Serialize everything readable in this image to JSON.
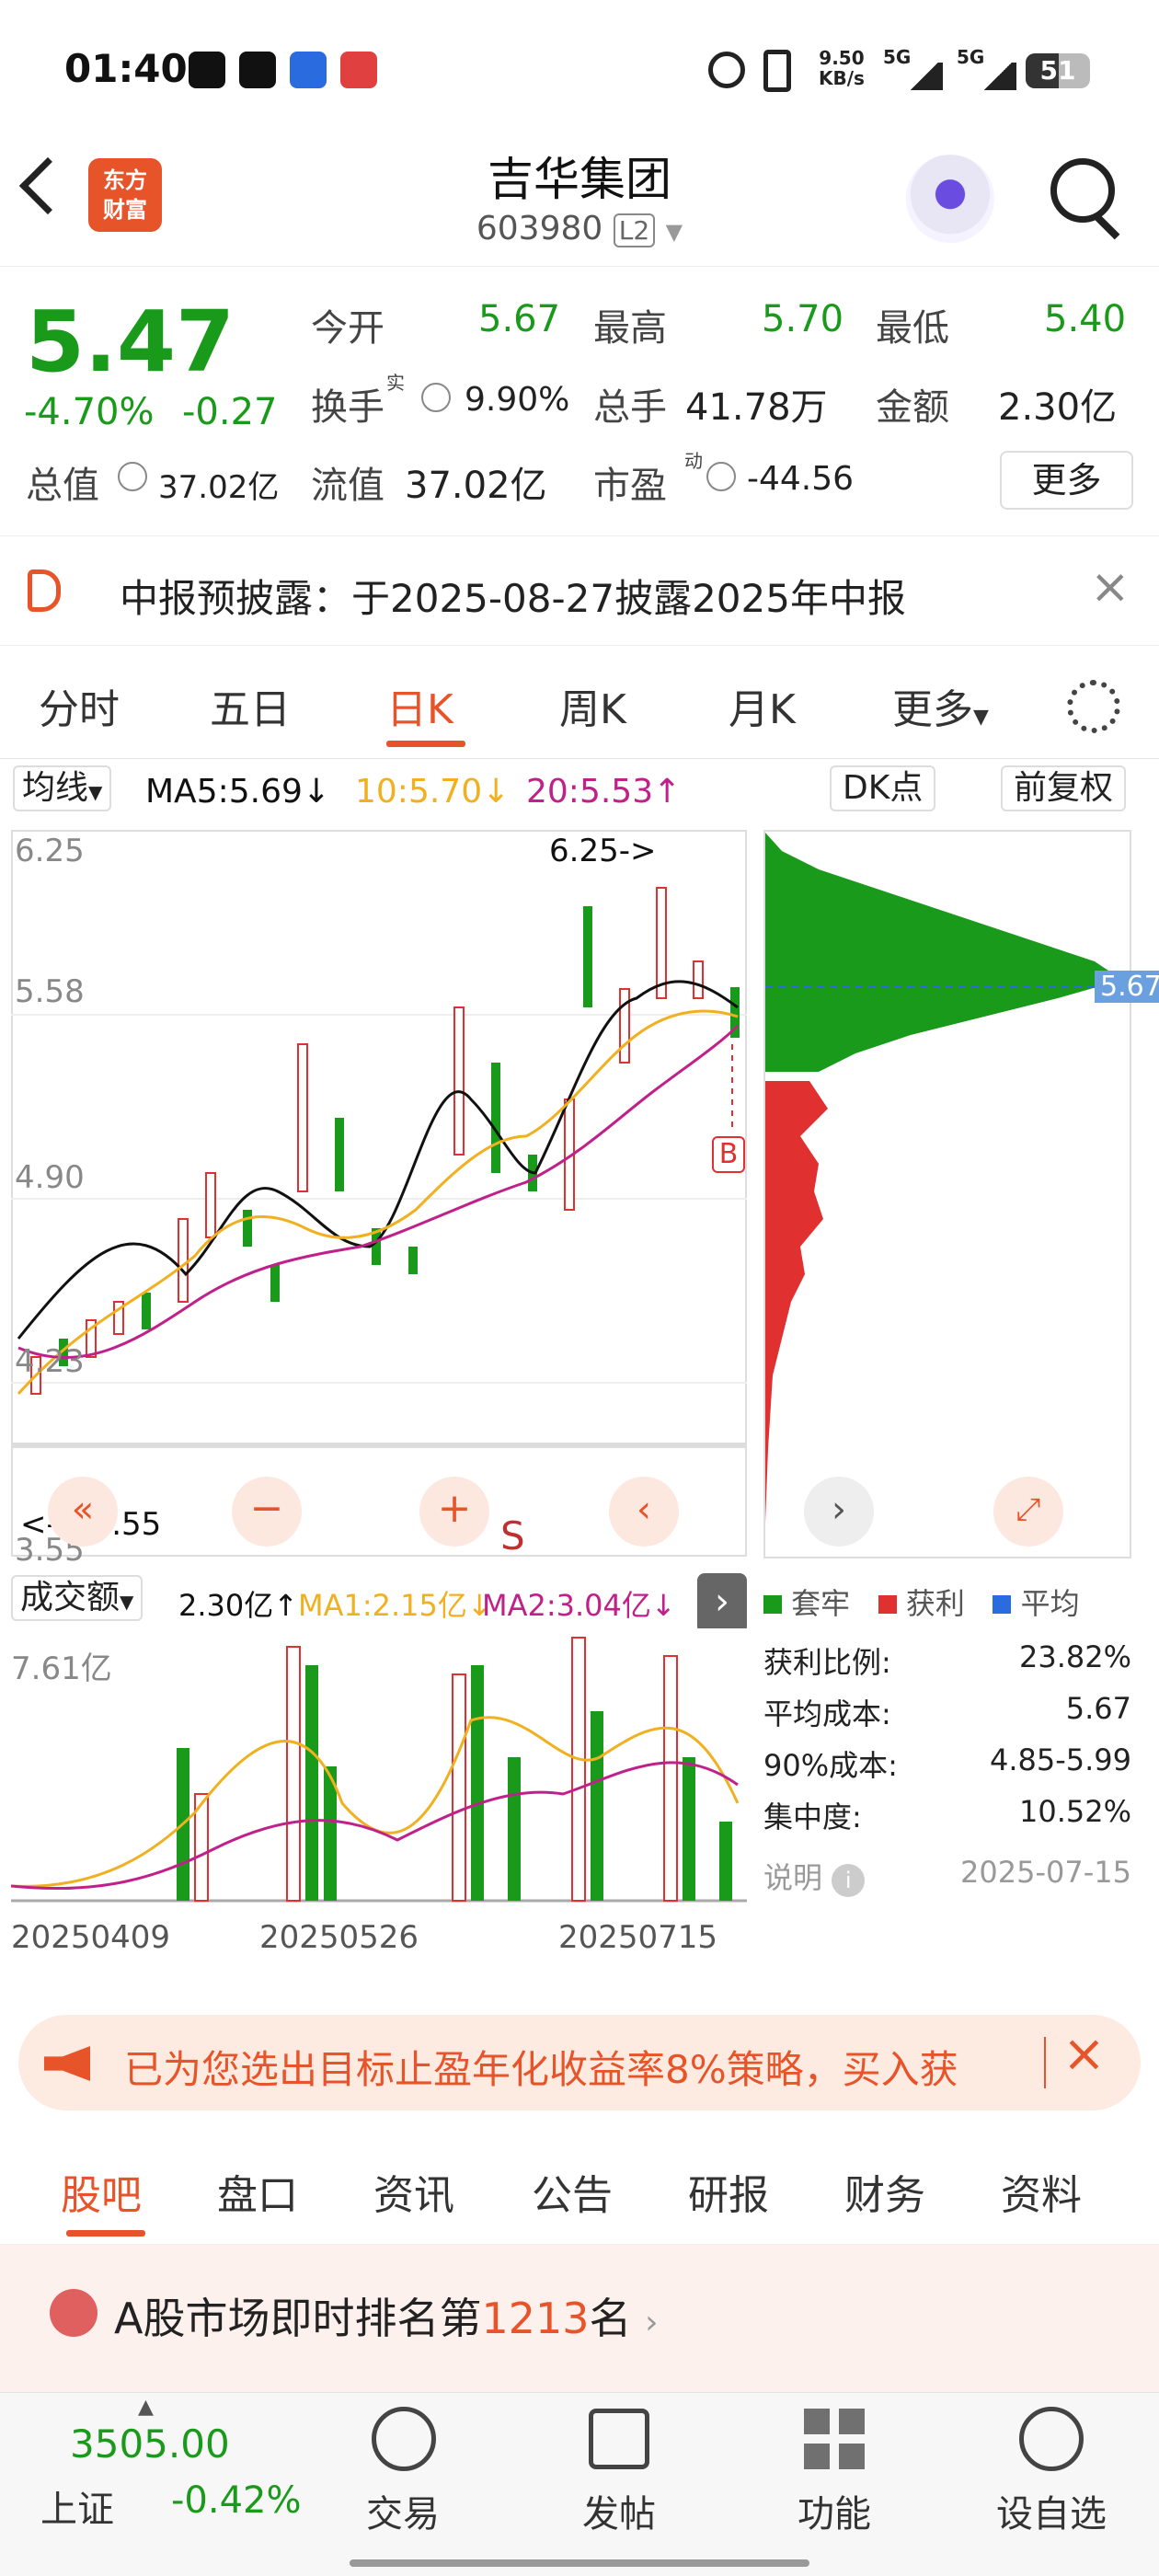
{
  "status_bar": {
    "time": "01:40",
    "net_speed": "9.50",
    "net_unit": "KB/s",
    "signal1": "5G",
    "signal2": "5G",
    "battery": "51"
  },
  "header": {
    "title": "吉华集团",
    "code": "603980",
    "level": "L2",
    "logo_line1": "东方",
    "logo_line2": "财富"
  },
  "quote": {
    "price": "5.47",
    "change_pct": "-4.70%",
    "change": "-0.27",
    "open_label": "今开",
    "open": "5.67",
    "high_label": "最高",
    "high": "5.70",
    "low_label": "最低",
    "low": "5.40",
    "turnover_label": "换手",
    "turnover_sup": "实",
    "turnover": "9.90%",
    "volume_label": "总手",
    "volume": "41.78万",
    "amount_label": "金额",
    "amount": "2.30亿",
    "total_value_label": "总值",
    "total_value": "37.02亿",
    "float_value_label": "流值",
    "float_value": "37.02亿",
    "pe_label": "市盈",
    "pe_sup": "动",
    "pe": "-44.56",
    "more_button": "更多"
  },
  "banner": {
    "text": "中报预披露：于2025-08-27披露2025年中报"
  },
  "tabs": [
    "分时",
    "五日",
    "日K",
    "周K",
    "月K",
    "更多"
  ],
  "active_tab": "日K",
  "ma_row": {
    "selector": "均线",
    "ma5": "MA5:5.69",
    "ma10": "10:5.70",
    "ma20": "20:5.53",
    "dk": "DK点",
    "fq": "前复权"
  },
  "kline": {
    "y_labels": [
      "6.25",
      "5.58",
      "4.90",
      "4.23",
      "3.55"
    ],
    "high_marker": "6.25->",
    "low_marker": "<----3.55",
    "b_marker": "B",
    "s_marker": "S"
  },
  "volume": {
    "selector": "成交额",
    "value": "2.30亿",
    "ma1": "MA1:2.15亿",
    "ma2": "MA2:3.04亿",
    "max_label": "7.61亿",
    "dates": [
      "20250409",
      "20250526",
      "20250715"
    ]
  },
  "chips": {
    "cost_tag": "5.67",
    "legend": [
      "套牢",
      "获利",
      "平均"
    ],
    "rows": [
      {
        "k": "获利比例:",
        "v": "23.82%"
      },
      {
        "k": "平均成本:",
        "v": "5.67"
      },
      {
        "k": "90%成本:",
        "v": "4.85-5.99"
      },
      {
        "k": "集中度:",
        "v": "10.52%"
      }
    ],
    "note": "说明",
    "date": "2025-07-15"
  },
  "promo": {
    "text": "已为您选出目标止盈年化收益率8%策略，买入获"
  },
  "bottom_tabs": [
    "股吧",
    "盘口",
    "资讯",
    "公告",
    "研报",
    "财务",
    "资料"
  ],
  "rank": {
    "prefix": "A股市场即时排名第",
    "num": "1213",
    "suffix": "名"
  },
  "nav": {
    "index_value": "3505.00",
    "index_name": "上证",
    "index_change": "-0.42%",
    "items": [
      "交易",
      "发帖",
      "功能",
      "设自选"
    ]
  },
  "colors": {
    "up": "#e03030",
    "down": "#1a9a1a",
    "accent": "#e8542a",
    "ma5": "#111111",
    "ma10": "#f0b020",
    "ma20": "#c0208a"
  }
}
